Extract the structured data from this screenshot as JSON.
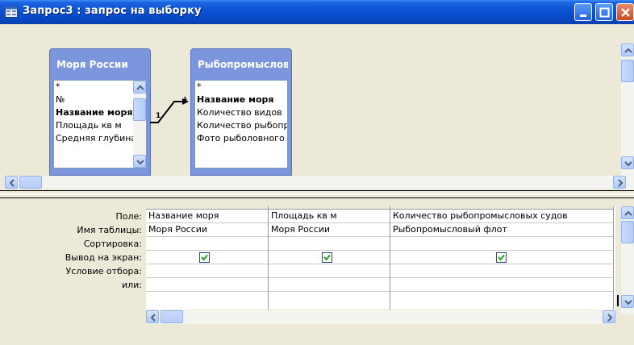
{
  "window": {
    "title": "Запрос3 : запрос на выборку"
  },
  "tables": [
    {
      "title": "Моря России",
      "fields": [
        "*",
        "№",
        "Название моря",
        "Площадь кв м",
        "Средняя глубина"
      ],
      "bold_field": "Название моря"
    },
    {
      "title": "Рыбопромысловый флот",
      "fields": [
        "*",
        "Название моря",
        "Количество видов",
        "Количество рыбопромысловых судов",
        "Фото рыболовного"
      ],
      "bold_field": "Название моря"
    }
  ],
  "relationship": {
    "left_label": "1",
    "right_label": "1"
  },
  "grid": {
    "row_labels": [
      "Поле:",
      "Имя таблицы:",
      "Сортировка:",
      "Вывод на экран:",
      "Условие отбора:",
      "или:"
    ],
    "columns": [
      {
        "field": "Название моря",
        "table": "Моря России",
        "sort": "",
        "show": true,
        "criteria": "",
        "or": ""
      },
      {
        "field": "Площадь кв м",
        "table": "Моря России",
        "sort": "",
        "show": true,
        "criteria": "",
        "or": ""
      },
      {
        "field": "Количество рыбопромысловых судов",
        "table": "Рыбопромысловый флот",
        "sort": "",
        "show": true,
        "criteria": "",
        "or": ""
      }
    ]
  },
  "colors": {
    "titlebar": "#0a51d4",
    "table_header": "#7b96dc",
    "check": "#21a121"
  }
}
